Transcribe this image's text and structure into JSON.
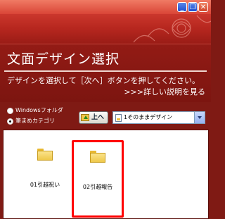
{
  "window": {
    "controls": {
      "minimize": "_",
      "restore": "❐",
      "close": "✕"
    },
    "theme": {
      "banner_red": "#cf3a2f",
      "header_red": "#8a1812",
      "selection": "#ff0000"
    }
  },
  "header": {
    "title": "文面デザイン選択",
    "instruction": "デザインを選択して［次へ］ボタンを押してください。",
    "detail_link": ">>>詳しい説明を見る"
  },
  "source": {
    "options": [
      {
        "label": "Windowsフォルダ",
        "selected": false
      },
      {
        "label": "筆まめカテゴリ",
        "selected": true
      }
    ]
  },
  "toolbar": {
    "up_label": "上へ",
    "category_select": "1そのままデザイン"
  },
  "files": [
    {
      "name": "01引越祝い",
      "type": "folder",
      "selected": false
    },
    {
      "name": "02引越報告",
      "type": "folder",
      "selected": true
    }
  ]
}
